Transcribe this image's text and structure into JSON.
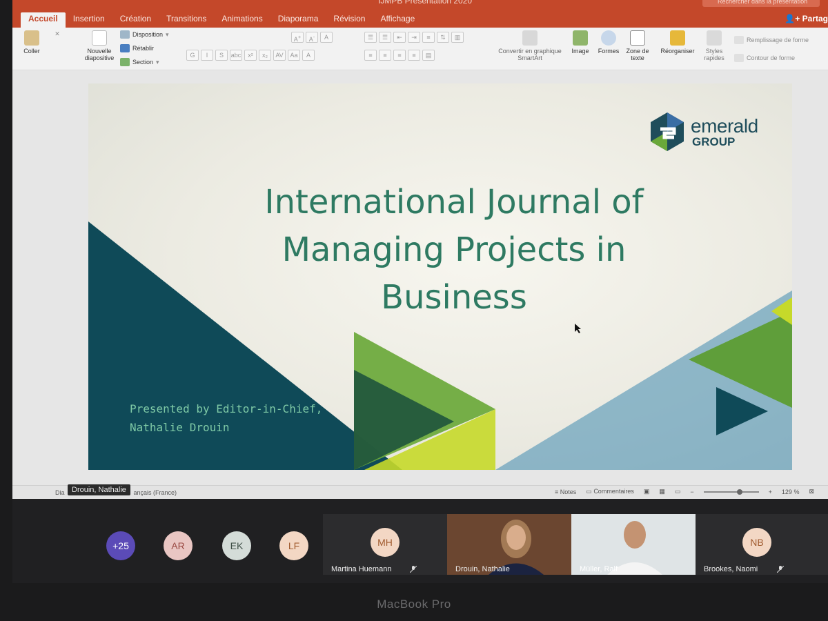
{
  "window": {
    "title": "IJMPB Présentation 2020",
    "search_placeholder": "Rechercher dans la présentation",
    "share_label": "Partag"
  },
  "tabs": [
    {
      "label": "Accueil",
      "active": true
    },
    {
      "label": "Insertion"
    },
    {
      "label": "Création"
    },
    {
      "label": "Transitions"
    },
    {
      "label": "Animations"
    },
    {
      "label": "Diaporama"
    },
    {
      "label": "Révision"
    },
    {
      "label": "Affichage"
    }
  ],
  "ribbon": {
    "paste": "Coller",
    "new_slide": "Nouvelle diapositive",
    "layout": "Disposition",
    "reset": "Rétablir",
    "section": "Section",
    "bold": "G",
    "italic": "I",
    "underline": "S",
    "strikethrough": "abc",
    "superscript": "x²",
    "subscript": "x₂",
    "convert_smartart": "Convertir en graphique SmartArt",
    "image": "Image",
    "shapes": "Formes",
    "textbox": "Zone de texte",
    "arrange": "Réorganiser",
    "quick_styles": "Styles rapides",
    "shape_fill": "Remplissage de forme",
    "shape_outline": "Contour de forme"
  },
  "slide": {
    "logo_word": "emerald",
    "logo_group": "GROUP",
    "title_lines": [
      "International Journal of",
      "Managing Projects in",
      "Business"
    ],
    "presenter_lines": [
      "Presented by Editor-in-Chief,",
      "Nathalie Drouin"
    ]
  },
  "statusbar": {
    "left": "Dia",
    "language": "ançais (France)",
    "notes": "Notes",
    "comments": "Commentaires",
    "zoom": "129 %"
  },
  "tooltip": {
    "name": "Drouin, Nathalie"
  },
  "participants": {
    "overflow_count": "+25",
    "avatars": [
      "AR",
      "EK",
      "LF"
    ],
    "tiles": [
      {
        "initials": "MH",
        "name": "Martina Huemann",
        "muted": true
      },
      {
        "initials": "",
        "name": "Drouin, Nathalie",
        "video": true
      },
      {
        "initials": "",
        "name": "Müller, Ralf",
        "video": true
      },
      {
        "initials": "NB",
        "name": "Brookes, Naomi",
        "muted": true
      }
    ]
  },
  "device": {
    "brand": "MacBook Pro"
  },
  "colors": {
    "ribbon_accent": "#c4482a",
    "slide_title": "#2e7a62",
    "dark_teal": "#0f4a58",
    "green": "#6aa83a",
    "lime": "#c6d92a"
  }
}
